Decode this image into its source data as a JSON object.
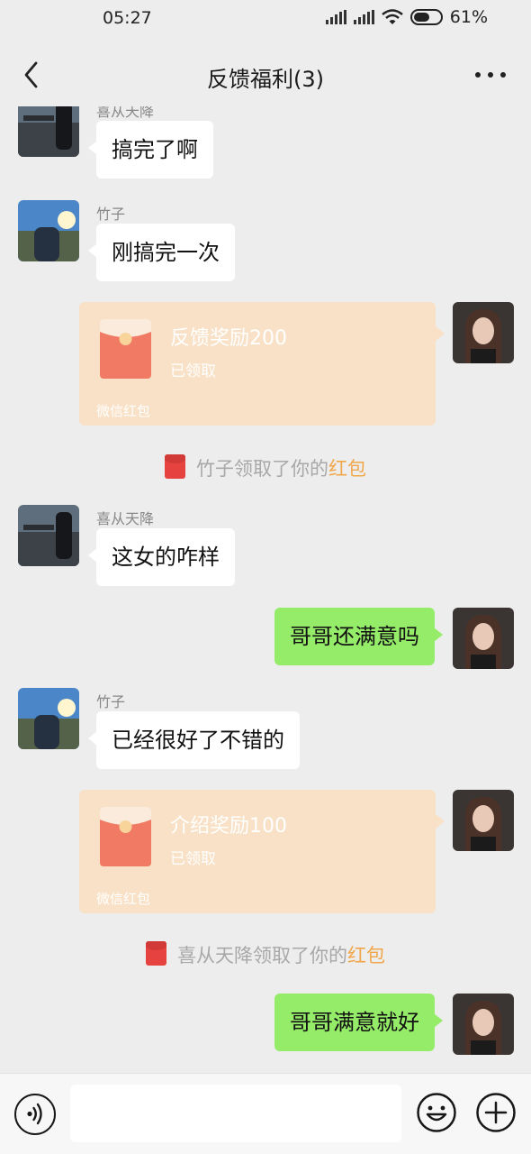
{
  "status": {
    "time": "05:27",
    "battery": "61%",
    "battery_level": 0.61
  },
  "nav": {
    "title": "反馈福利(3)"
  },
  "messages": [
    {
      "type": "incoming",
      "sender": "喜从天降",
      "text": "搞完了啊"
    },
    {
      "type": "incoming",
      "sender": "竹子",
      "text": "刚搞完一次"
    },
    {
      "type": "redpacket",
      "title": "反馈奖励200",
      "status": "已领取",
      "brand": "微信红包"
    },
    {
      "type": "system",
      "prefix": "竹子领取了你的",
      "highlight": "红包"
    },
    {
      "type": "incoming",
      "sender": "喜从天降",
      "text": "这女的咋样"
    },
    {
      "type": "outgoing",
      "text": "哥哥还满意吗"
    },
    {
      "type": "incoming",
      "sender": "竹子",
      "text": "已经很好了不错的"
    },
    {
      "type": "redpacket",
      "title": "介绍奖励100",
      "status": "已领取",
      "brand": "微信红包"
    },
    {
      "type": "system",
      "prefix": "喜从天降领取了你的",
      "highlight": "红包"
    },
    {
      "type": "outgoing",
      "text": "哥哥满意就好"
    }
  ],
  "input": {
    "value": "",
    "placeholder": ""
  },
  "icons": {
    "back": "chevron-left-icon",
    "more": "more-dots-icon",
    "voice": "voice-icon",
    "emoji": "emoji-icon",
    "plus": "plus-icon",
    "redpacket": "red-packet-icon"
  },
  "colors": {
    "background": "#ededed",
    "outgoing_bubble": "#95ec69",
    "incoming_bubble": "#ffffff",
    "redpacket_bg": "#f8e1c6",
    "redpacket_red": "#f07a63",
    "highlight": "#f0a74b"
  }
}
